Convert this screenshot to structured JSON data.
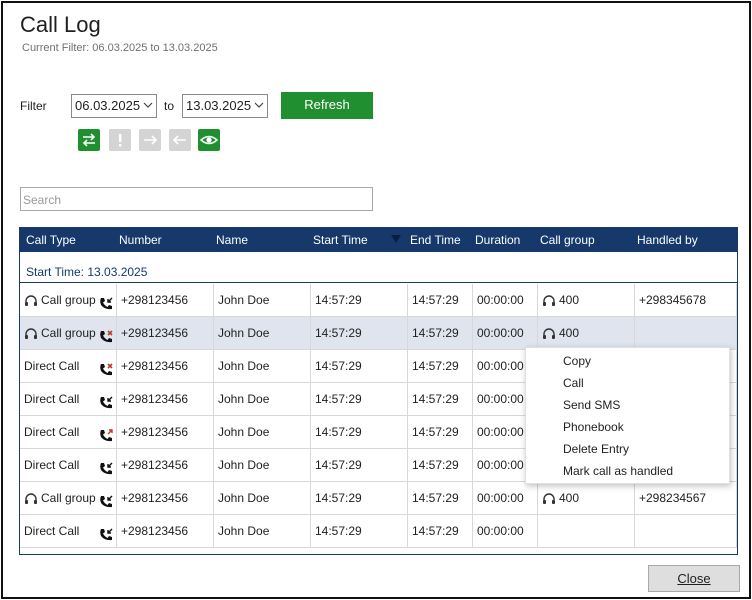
{
  "window": {
    "title": "Call Log",
    "subtitle": "Current Filter: 06.03.2025 to 13.03.2025"
  },
  "filter": {
    "label": "Filter",
    "from_value": "06.03.2025",
    "to_label": "to",
    "to_value": "13.03.2025",
    "refresh_label": "Refresh"
  },
  "toggles": [
    {
      "icon": "swap-arrows-icon",
      "active": true
    },
    {
      "icon": "exclamation-icon",
      "active": false
    },
    {
      "icon": "arrow-right-icon",
      "active": false
    },
    {
      "icon": "arrow-left-icon",
      "active": false
    },
    {
      "icon": "eye-icon",
      "active": true
    }
  ],
  "search": {
    "placeholder": "Search"
  },
  "table": {
    "columns": [
      "Call Type",
      "Number",
      "Name",
      "Start Time",
      "End Time",
      "Duration",
      "Call group",
      "Handled by"
    ],
    "group_header": "Start Time: 13.03.2025",
    "rows": [
      {
        "type": "Call group",
        "type_icon": "headset-icon",
        "status": "phone-incoming-icon",
        "number": "+298123456",
        "name": "John Doe",
        "start": "14:57:29",
        "end": "14:57:29",
        "duration": "00:00:00",
        "group": "400",
        "handled_by": "+298345678"
      },
      {
        "type": "Call group",
        "type_icon": "headset-icon",
        "status": "phone-missed-icon",
        "number": "+298123456",
        "name": "John Doe",
        "start": "14:57:29",
        "end": "14:57:29",
        "duration": "00:00:00",
        "group": "400",
        "handled_by": ""
      },
      {
        "type": "Direct Call",
        "type_icon": "",
        "status": "phone-missed-icon",
        "number": "+298123456",
        "name": "John Doe",
        "start": "14:57:29",
        "end": "14:57:29",
        "duration": "00:00:00",
        "group": "",
        "handled_by": ""
      },
      {
        "type": "Direct Call",
        "type_icon": "",
        "status": "phone-incoming-icon",
        "number": "+298123456",
        "name": "John Doe",
        "start": "14:57:29",
        "end": "14:57:29",
        "duration": "00:00:00",
        "group": "",
        "handled_by": ""
      },
      {
        "type": "Direct Call",
        "type_icon": "",
        "status": "phone-outgoing-missed-icon",
        "number": "+298123456",
        "name": "John Doe",
        "start": "14:57:29",
        "end": "14:57:29",
        "duration": "00:00:00",
        "group": "",
        "handled_by": ""
      },
      {
        "type": "Direct Call",
        "type_icon": "",
        "status": "phone-incoming-icon",
        "number": "+298123456",
        "name": "John Doe",
        "start": "14:57:29",
        "end": "14:57:29",
        "duration": "00:00:00",
        "group": "",
        "handled_by": ""
      },
      {
        "type": "Call group",
        "type_icon": "headset-icon",
        "status": "phone-incoming-icon",
        "number": "+298123456",
        "name": "John Doe",
        "start": "14:57:29",
        "end": "14:57:29",
        "duration": "00:00:00",
        "group": "400",
        "handled_by": "+298234567"
      },
      {
        "type": "Direct Call",
        "type_icon": "",
        "status": "phone-incoming-icon",
        "number": "+298123456",
        "name": "John Doe",
        "start": "14:57:29",
        "end": "14:57:29",
        "duration": "00:00:00",
        "group": "",
        "handled_by": ""
      }
    ]
  },
  "context_menu": {
    "items": [
      "Copy",
      "Call",
      "Send SMS",
      "Phonebook",
      "Delete Entry",
      "Mark call as handled"
    ]
  },
  "footer": {
    "close_label": "Close"
  },
  "colors": {
    "header_bg": "#16386b",
    "accent_green": "#1f8f2f",
    "missed_red": "#c0392b",
    "selected_row": "#dfe4ee"
  }
}
